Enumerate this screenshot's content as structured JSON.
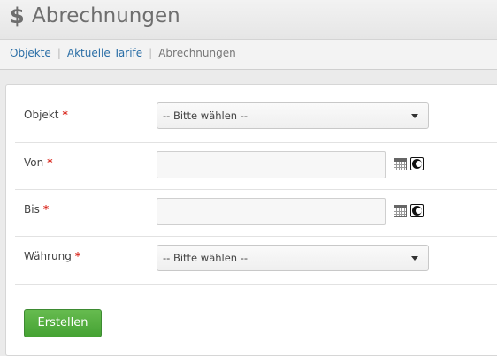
{
  "header": {
    "icon": "dollar-icon",
    "title": "Abrechnungen"
  },
  "breadcrumb": {
    "items": [
      "Objekte",
      "Aktuelle Tarife"
    ],
    "current": "Abrechnungen"
  },
  "form": {
    "fields": [
      {
        "label": "Objekt",
        "required": "*",
        "type": "select",
        "value": "-- Bitte wählen --"
      },
      {
        "label": "Von",
        "required": "*",
        "type": "date",
        "value": ""
      },
      {
        "label": "Bis",
        "required": "*",
        "type": "date",
        "value": ""
      },
      {
        "label": "Währung",
        "required": "*",
        "type": "select",
        "value": "-- Bitte wählen --"
      }
    ],
    "submit_label": "Erstellen"
  },
  "colors": {
    "primary_button": "#45a233",
    "required_marker": "#d9261c",
    "link": "#2a6ea6"
  }
}
